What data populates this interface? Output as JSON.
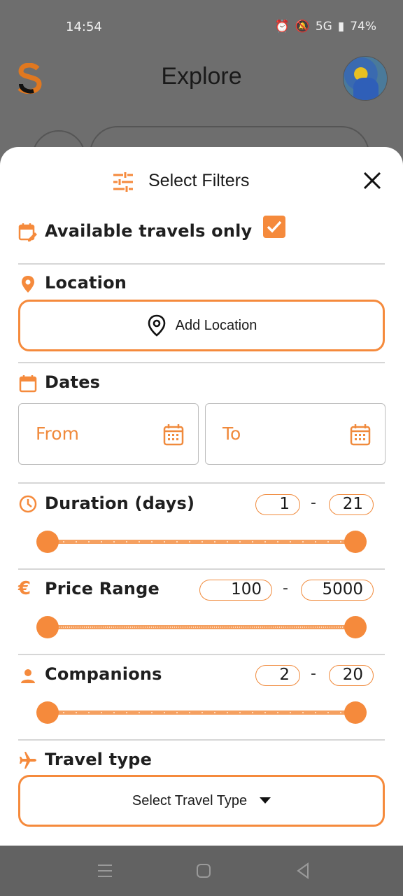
{
  "status": {
    "time": "14:54",
    "signal": "5G",
    "battery": "74%"
  },
  "app_bar": {
    "title": "Explore"
  },
  "sheet": {
    "title": "Select Filters",
    "available": {
      "label": "Available travels only",
      "checked": true
    },
    "location": {
      "label": "Location",
      "button": "Add Location"
    },
    "dates": {
      "label": "Dates",
      "from": "From",
      "to": "To"
    },
    "duration": {
      "label": "Duration (days)",
      "min": "1",
      "max": "21"
    },
    "price": {
      "label": "Price Range",
      "min": "100",
      "max": "5000"
    },
    "companions": {
      "label": "Companions",
      "min": "2",
      "max": "20"
    },
    "travel_type": {
      "label": "Travel type",
      "select": "Select Travel Type"
    }
  },
  "colors": {
    "accent": "#f58a3c",
    "accent_text": "#f08a3c",
    "divider": "#d6d6d6"
  },
  "icons": [
    "filter-icon",
    "close-icon",
    "calendar-edit-icon",
    "location-pin-icon",
    "calendar-icon",
    "clock-icon",
    "euro-icon",
    "person-icon",
    "airplane-icon",
    "menu-icon",
    "home-icon",
    "back-icon"
  ]
}
